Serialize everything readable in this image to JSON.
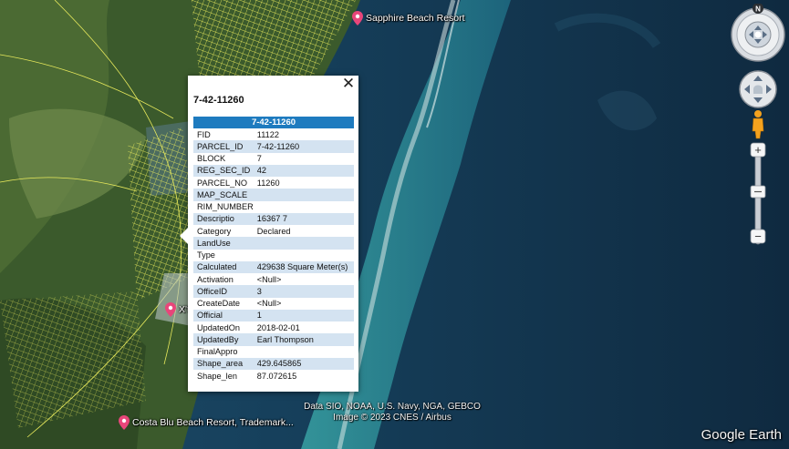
{
  "placemarks": [
    {
      "label": "Sapphire Beach Resort",
      "icon": "placemark-pin-icon"
    },
    {
      "label": "X'tan Ha",
      "icon": "placemark-pin-icon"
    },
    {
      "label": "Costa Blu Beach Resort, Trademark...",
      "icon": "placemark-pin-icon"
    }
  ],
  "attribution": {
    "line1": "Data SIO, NOAA, U.S. Navy, NGA, GEBCO",
    "line2": "Image © 2023 CNES / Airbus"
  },
  "logo": "Google Earth",
  "popup": {
    "close": "✕",
    "title": "7-42-11260",
    "header": "7-42-11260",
    "rows": [
      {
        "key": "FID",
        "value": "11122"
      },
      {
        "key": "PARCEL_ID",
        "value": "7-42-11260"
      },
      {
        "key": "BLOCK",
        "value": "7"
      },
      {
        "key": "REG_SEC_ID",
        "value": "42"
      },
      {
        "key": "PARCEL_NO",
        "value": "11260"
      },
      {
        "key": "MAP_SCALE",
        "value": ""
      },
      {
        "key": "RIM_NUMBER",
        "value": ""
      },
      {
        "key": "Descriptio",
        "value": "16367 7"
      },
      {
        "key": "Category",
        "value": "Declared"
      },
      {
        "key": "LandUse",
        "value": ""
      },
      {
        "key": "Type",
        "value": ""
      },
      {
        "key": "Calculated",
        "value": "429638 Square Meter(s)"
      },
      {
        "key": "Activation",
        "value": "<Null>"
      },
      {
        "key": "OfficeID",
        "value": "3"
      },
      {
        "key": "CreateDate",
        "value": "<Null>"
      },
      {
        "key": "Official",
        "value": "1"
      },
      {
        "key": "UpdatedOn",
        "value": "2018-02-01"
      },
      {
        "key": "UpdatedBy",
        "value": "Earl Thompson"
      },
      {
        "key": "FinalAppro",
        "value": ""
      },
      {
        "key": "Shape_area",
        "value": "429.645865"
      },
      {
        "key": "Shape_len",
        "value": "87.072615"
      }
    ]
  },
  "nav": {
    "compass_north": "N",
    "zoom_in": "+",
    "zoom_out": "−",
    "icons": [
      "compass-icon",
      "look-joystick-icon",
      "move-joystick-icon",
      "pegman-icon"
    ]
  },
  "colors": {
    "ocean_deep": "#10304a",
    "reef": "#2f8f9a",
    "land": "#3c5a2c",
    "parcel_lines": "#f3f070",
    "header": "#1e7bbf",
    "row_alt": "#d4e3f1"
  }
}
